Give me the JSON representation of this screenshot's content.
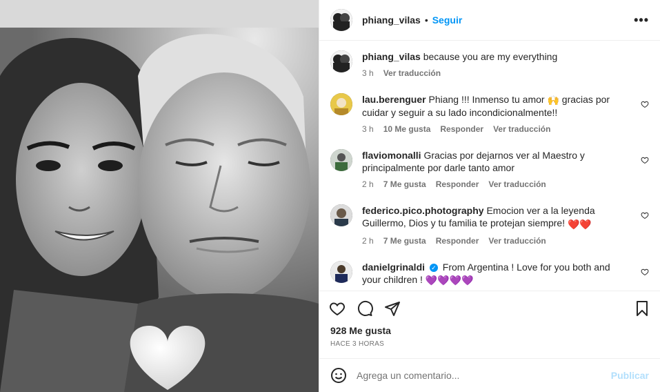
{
  "post": {
    "username": "phiang_vilas",
    "follow_label": "Seguir",
    "separator": "•",
    "more_label": "•••",
    "caption": {
      "username": "phiang_vilas",
      "text": "because you are my everything",
      "time": "3 h",
      "translate": "Ver traducción"
    },
    "comments": [
      {
        "username": "lau.berenguer",
        "text_before": "Phiang !!! Inmenso tu amor",
        "emoji": "🙌",
        "text_after": "gracias por cuidar y seguir a su lado incondicionalmente!!",
        "time": "3 h",
        "likes": "10 Me gusta",
        "reply": "Responder",
        "translate": "Ver traducción"
      },
      {
        "username": "flaviomonalli",
        "text": "Gracias por dejarnos ver al Maestro y principalmente por darle tanto amor",
        "time": "2 h",
        "likes": "7 Me gusta",
        "reply": "Responder",
        "translate": "Ver traducción"
      },
      {
        "username": "federico.pico.photography",
        "text": "Emocion ver a la leyenda Guillermo, Dios y tu familia te protejan siempre!",
        "emoji": "❤️❤️",
        "time": "2 h",
        "likes": "7 Me gusta",
        "reply": "Responder",
        "translate": "Ver traducción"
      },
      {
        "username": "danielgrinaldi",
        "verified": "✓",
        "text": "From Argentina ! Love for you both and your children !",
        "emoji": "💜💜💜💜"
      }
    ],
    "likes": "928 Me gusta",
    "time_ago": "HACE 3 HORAS",
    "comment_placeholder": "Agrega un comentario...",
    "publish_label": "Publicar",
    "colors": {
      "link_blue": "#0095f6",
      "publish_disabled": "#b2dffc",
      "muted": "#737373"
    },
    "icons": [
      "heart-icon",
      "comment-icon",
      "share-icon",
      "bookmark-icon",
      "emoji-icon",
      "small-heart-icon",
      "verified-badge-icon"
    ]
  }
}
